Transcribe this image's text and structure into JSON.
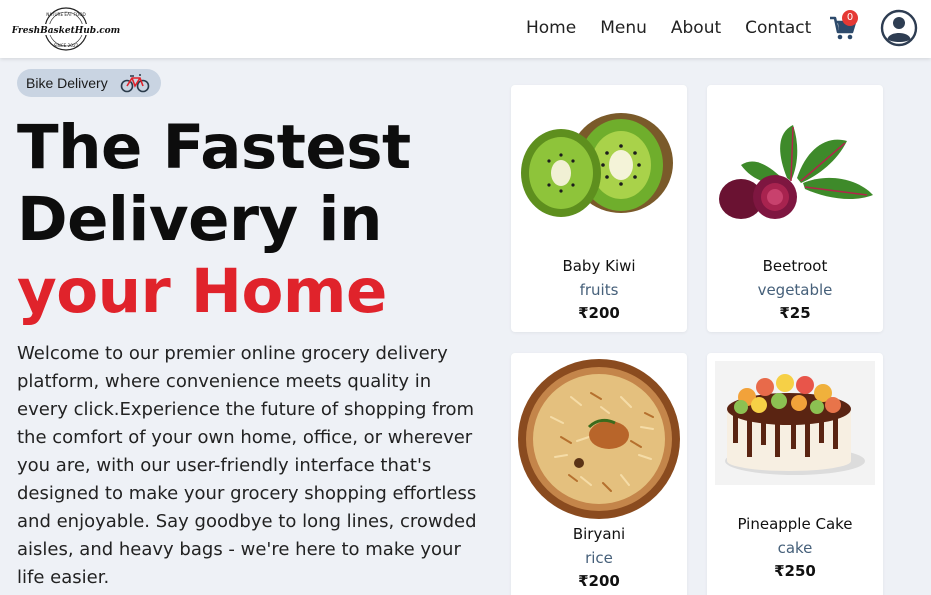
{
  "header": {
    "logo_text": "FreshBasketHub.com",
    "logo_top_text": "NATURE  EAT  FOOD",
    "logo_bottom_text": "SINCE 2022",
    "nav": [
      "Home",
      "Menu",
      "About",
      "Contact"
    ],
    "cart_count": "0",
    "cart_icon": "cart-icon",
    "profile_icon": "user-avatar-icon"
  },
  "hero": {
    "pill_label": "Bike Delivery",
    "pill_icon": "bicycle-icon",
    "headline_line1": "The Fastest",
    "headline_line2": "Delivery in",
    "headline_line3": "your Home",
    "intro": "Welcome to our premier online grocery delivery platform, where convenience meets quality in every click.Experience the future of shopping from the comfort of your own home, office, or wherever you are, with our user-friendly interface that's designed to make your grocery shopping effortless and enjoyable. Say goodbye to long lines, crowded aisles, and heavy bags - we're here to make your life easier."
  },
  "products": [
    {
      "name": "Baby Kiwi",
      "category": "fruits",
      "price": "₹200",
      "image": "kiwi"
    },
    {
      "name": "Beetroot",
      "category": "vegetable",
      "price": "₹25",
      "image": "beetroot"
    },
    {
      "name": "Biryani",
      "category": "rice",
      "price": "₹200",
      "image": "biryani"
    },
    {
      "name": "Pineapple Cake",
      "category": "cake",
      "price": "₹250",
      "image": "cake"
    }
  ],
  "colors": {
    "accent_red": "#e0232b",
    "category_text": "#46607a",
    "background": "#eef1f6",
    "pill": "#c9d4e2"
  }
}
